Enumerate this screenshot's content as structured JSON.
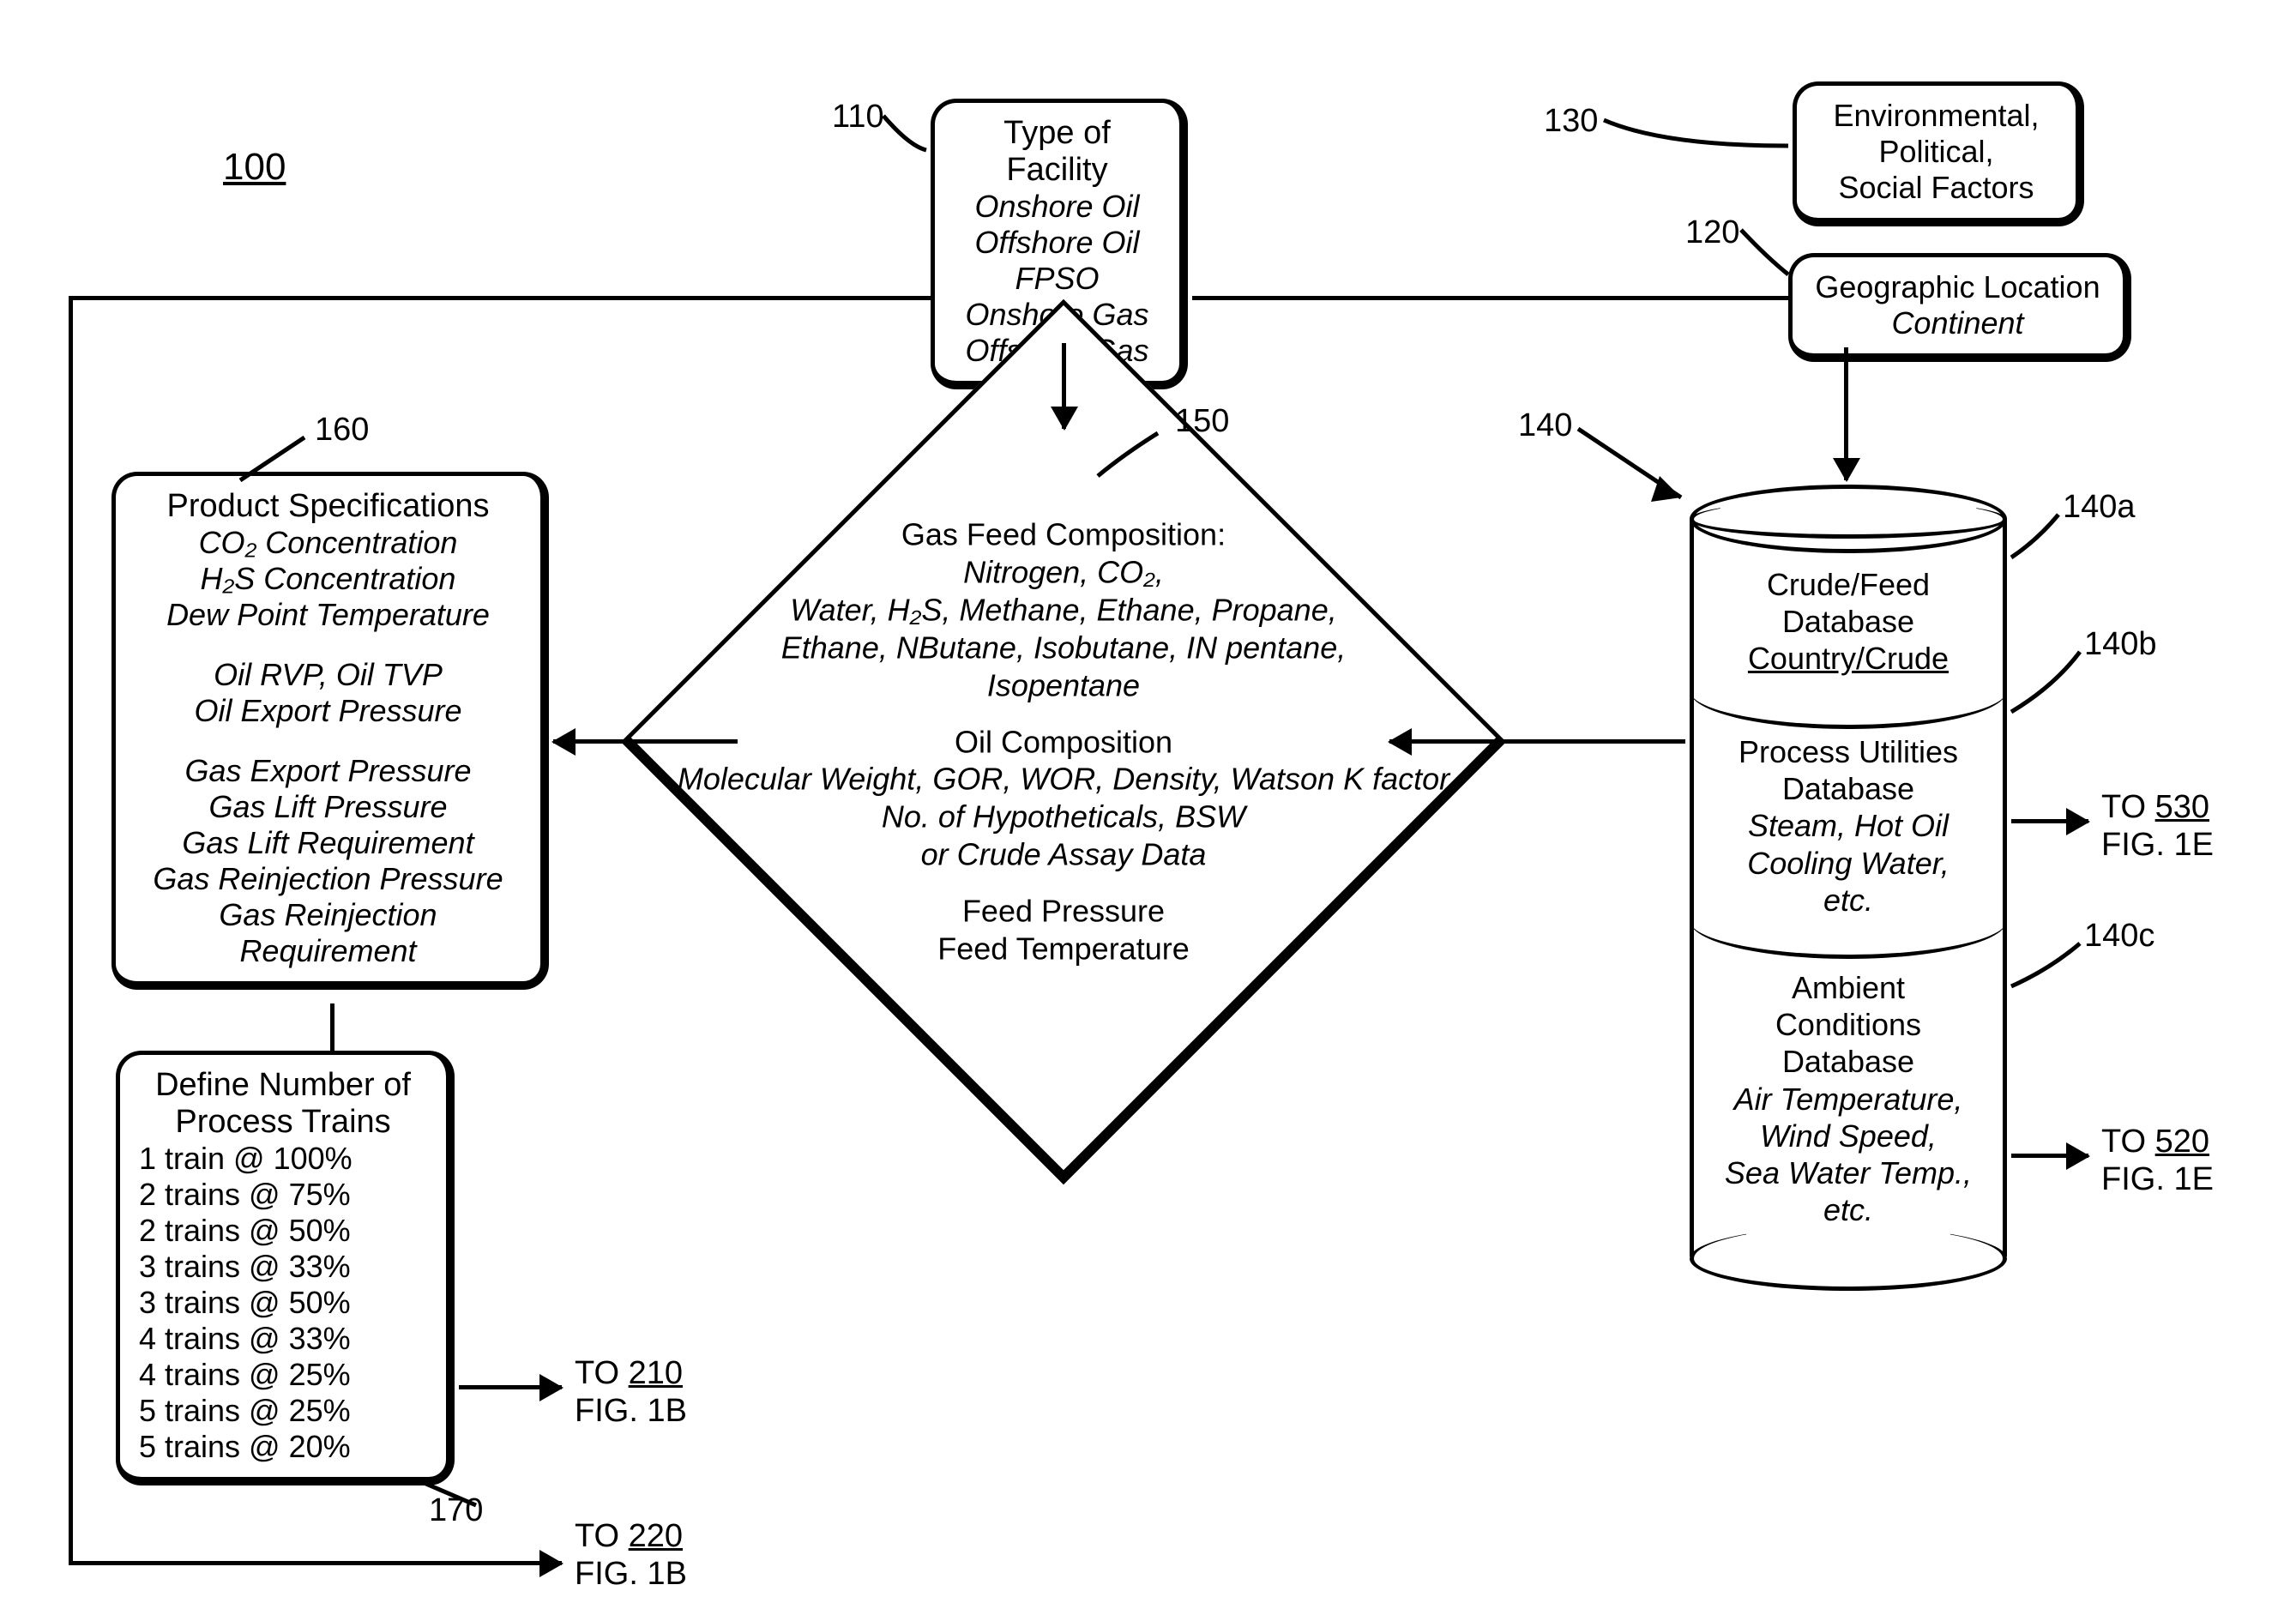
{
  "figure_id": "100",
  "refs": {
    "r110": "110",
    "r120": "120",
    "r130": "130",
    "r140": "140",
    "r140a": "140a",
    "r140b": "140b",
    "r140c": "140c",
    "r150": "150",
    "r160": "160",
    "r170": "170"
  },
  "box110": {
    "title": "Type of Facility",
    "items": [
      "Onshore Oil",
      "Offshore Oil",
      "FPSO",
      "Onshore Gas",
      "Offshore Gas"
    ]
  },
  "box130": {
    "lines": [
      "Environmental,",
      "Political,",
      "Social Factors"
    ]
  },
  "box120": {
    "title": "Geographic Location",
    "sub": "Continent"
  },
  "diamond150": {
    "g1_title": "Gas Feed Composition:",
    "g1_l1": "Nitrogen, CO₂,",
    "g1_l2": "Water, H₂S, Methane, Ethane, Propane,",
    "g1_l3": "Ethane, NButane, Isobutane, IN pentane,",
    "g1_l4": "Isopentane",
    "g2_title": "Oil Composition",
    "g2_l1": "Molecular Weight, GOR, WOR, Density, Watson K factor",
    "g2_l2": "No. of Hypotheticals, BSW",
    "g2_l3": "or Crude Assay Data",
    "g3_l1": "Feed Pressure",
    "g3_l2": "Feed Temperature"
  },
  "box160": {
    "title": "Product Specifications",
    "sec1": [
      "CO₂ Concentration",
      "H₂S Concentration",
      "Dew Point Temperature"
    ],
    "sec2": [
      "Oil RVP, Oil TVP",
      "Oil Export Pressure"
    ],
    "sec3": [
      "Gas Export Pressure",
      "Gas Lift Pressure",
      "Gas Lift Requirement",
      "Gas Reinjection Pressure",
      "Gas Reinjection Requirement"
    ]
  },
  "box170": {
    "title1": "Define Number of",
    "title2": "Process Trains",
    "items": [
      "1 train @ 100%",
      "2 trains @ 75%",
      "2 trains @ 50%",
      "3 trains @ 33%",
      "3 trains @ 50%",
      "4 trains @ 33%",
      "4 trains @ 25%",
      "5 trains @ 25%",
      "5 trains @ 20%"
    ]
  },
  "db": {
    "a_title": "Crude/Feed Database",
    "a_sub": "Country/Crude",
    "b_title": "Process Utilities Database",
    "b_sub": "Steam, Hot Oil Cooling Water, etc.",
    "c_title": "Ambient Conditions Database",
    "c_sub": "Air Temperature, Wind Speed, Sea Water Temp., etc."
  },
  "outlinks": {
    "to210": "TO 210",
    "to210_sub": "FIG. 1B",
    "to220": "TO 220",
    "to220_sub": "FIG. 1B",
    "to530": "TO 530",
    "to530_sub": "FIG. 1E",
    "to520": "TO 520",
    "to520_sub": "FIG. 1E"
  }
}
